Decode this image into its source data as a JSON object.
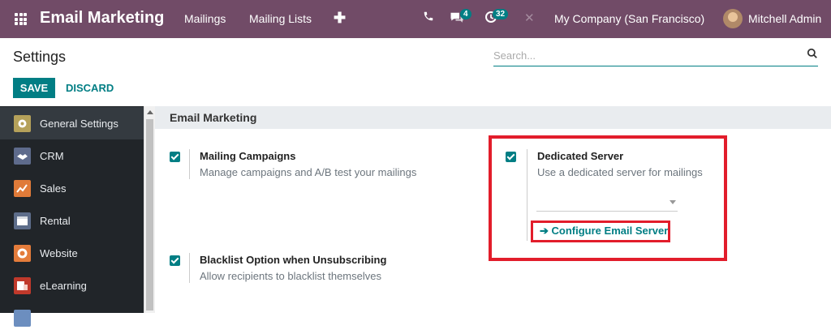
{
  "topbar": {
    "app_title": "Email Marketing",
    "menu": [
      "Mailings",
      "Mailing Lists"
    ],
    "messages_count": "4",
    "activities_count": "32",
    "company": "My Company (San Francisco)",
    "user": "Mitchell Admin",
    "bg_color": "#714b67"
  },
  "control": {
    "breadcrumb": "Settings",
    "search_placeholder": "Search...",
    "save_label": "SAVE",
    "discard_label": "DISCARD"
  },
  "sidebar": {
    "items": [
      {
        "label": "General Settings",
        "icon": "gear-icon",
        "color": "#b5a15a"
      },
      {
        "label": "CRM",
        "icon": "handshake-icon",
        "color": "#5e6b8c"
      },
      {
        "label": "Sales",
        "icon": "chart-icon",
        "color": "#e07b39"
      },
      {
        "label": "Rental",
        "icon": "calendar-icon",
        "color": "#5d6d8a"
      },
      {
        "label": "Website",
        "icon": "globe-icon",
        "color": "#e47c3b"
      },
      {
        "label": "eLearning",
        "icon": "elearning-icon",
        "color": "#c0392b"
      }
    ]
  },
  "section": {
    "title": "Email Marketing",
    "options": [
      {
        "title": "Mailing Campaigns",
        "desc": "Manage campaigns and A/B test your mailings",
        "checked": true
      },
      {
        "title": "Dedicated Server",
        "desc": "Use a dedicated server for mailings",
        "checked": true
      },
      {
        "title": "Blacklist Option when Unsubscribing",
        "desc": "Allow recipients to blacklist themselves",
        "checked": true
      }
    ],
    "configure_link": "Configure Email Server"
  },
  "colors": {
    "accent": "#017e84",
    "highlight": "#e21d2b"
  }
}
